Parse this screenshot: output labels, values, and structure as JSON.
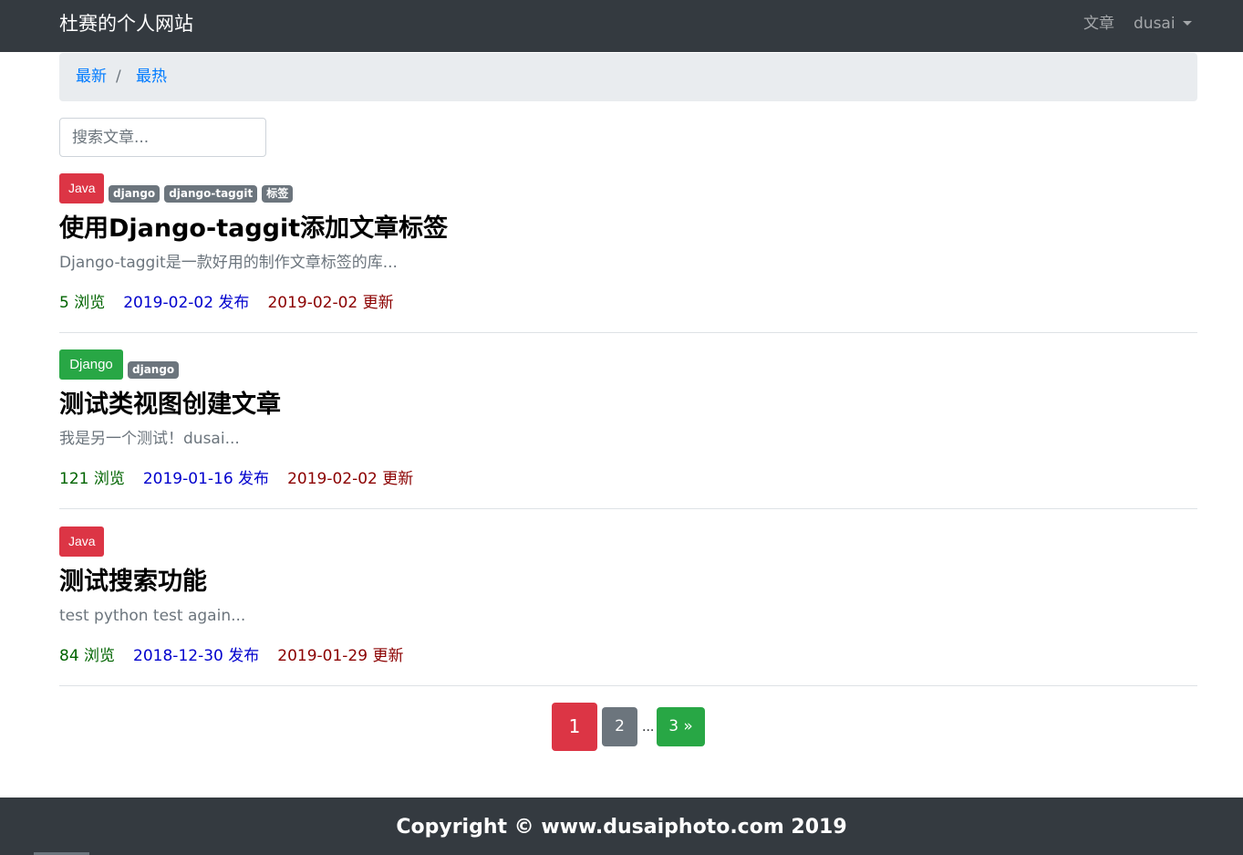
{
  "navbar": {
    "brand": "杜赛的个人网站",
    "articles_label": "文章",
    "user_label": "dusai"
  },
  "breadcrumb": {
    "newest": "最新",
    "separator": "/",
    "hottest": "最热"
  },
  "search": {
    "placeholder": "搜索文章..."
  },
  "articles": [
    {
      "category": "Java",
      "tags": [
        "django",
        "django-taggit",
        "标签"
      ],
      "title": "使用Django-taggit添加文章标签",
      "excerpt": "Django-taggit是一款好用的制作文章标签的库...",
      "views": "5 浏览",
      "created": "2019-02-02 发布",
      "updated": "2019-02-02 更新"
    },
    {
      "category": "Django",
      "tags": [
        "django"
      ],
      "title": "测试类视图创建文章",
      "excerpt": "我是另一个测试！dusai...",
      "views": "121 浏览",
      "created": "2019-01-16 发布",
      "updated": "2019-02-02 更新"
    },
    {
      "category": "Java",
      "tags": [],
      "title": "测试搜索功能",
      "excerpt": "test python test again...",
      "views": "84 浏览",
      "created": "2018-12-30 发布",
      "updated": "2019-01-29 更新"
    }
  ],
  "pagination": {
    "current": "1",
    "next": "2",
    "ellipsis": "...",
    "last": "3 »"
  },
  "footer": {
    "copyright": "Copyright © www.dusaiphoto.com 2019"
  },
  "colors": {
    "navbar": "#343a40",
    "danger": "#dc3545",
    "success": "#28a745",
    "secondary": "#6c757d",
    "link": "#007bff",
    "views": "#006400",
    "created": "#0000cd",
    "updated": "#8b0000"
  }
}
